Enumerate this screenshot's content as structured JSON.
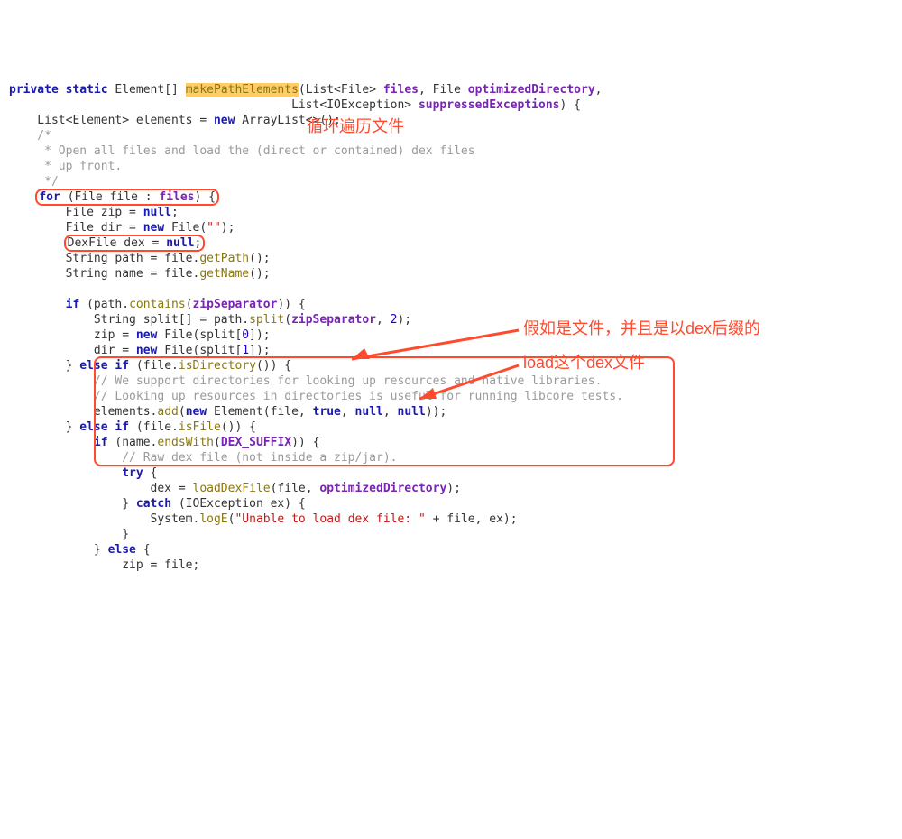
{
  "annotations": {
    "loop": "循环遍历文件",
    "isfile": "假如是文件，并且是以dex后缀的",
    "load": "load这个dex文件"
  },
  "code": {
    "sig1_pre": "private static ",
    "sig1_type": "Element[] ",
    "sig1_method": "makePathElements",
    "sig1_after": "(List<File> ",
    "sig1_p1": "files",
    "sig1_mid": ", File ",
    "sig1_p2": "optimizedDirectory",
    "sig1_end": ",",
    "sig2_pre": "                                        List<IOException> ",
    "sig2_p3": "suppressedExceptions",
    "sig2_end": ") {",
    "l3": "    List<Element> elements = ",
    "l3_new": "new",
    "l3_b": " ArrayList<>();",
    "c1": "    /*",
    "c2": "     * Open all files and load the (direct or contained) dex files",
    "c3": "     * up front.",
    "c4": "     */",
    "for_pre": "    ",
    "for_kw": "for",
    "for_body": " (File file : ",
    "for_files": "files",
    "for_end": ") {",
    "l_zip": "        File zip = ",
    "l_zip_null": "null",
    "l_zip_end": ";",
    "l_dir": "        File dir = ",
    "l_dir_new": "new",
    "l_dir_b": " File(",
    "l_dir_s": "\"\"",
    "l_dir_end": ");",
    "dex_pre": "        ",
    "dex_body": "DexFile dex = ",
    "dex_null": "null",
    "dex_end": ";",
    "l_path": "        String path = file.",
    "l_path_m": "getPath",
    "l_path_end": "();",
    "l_name": "        String name = file.",
    "l_name_m": "getName",
    "l_name_end": "();",
    "blank": "",
    "if1_pre": "        ",
    "if1_kw": "if",
    "if1_body": " (path.",
    "if1_m": "contains",
    "if1_p": "(",
    "if1_arg": "zipSeparator",
    "if1_end": ")) {",
    "spl_a": "            String split[] = path.",
    "spl_m": "split",
    "spl_b": "(",
    "spl_arg": "zipSeparator",
    "spl_c": ", ",
    "spl_n": "2",
    "spl_end": ");",
    "z2": "            zip = ",
    "z2_new": "new",
    "z2_b": " File(split[",
    "z2_n": "0",
    "z2_end": "]);",
    "d2": "            dir = ",
    "d2_new": "new",
    "d2_b": " File(split[",
    "d2_n": "1",
    "d2_end": "]);",
    "elif1_pre": "        } ",
    "elif1_kw": "else if",
    "elif1_body": " (file.",
    "elif1_m": "isDirectory",
    "elif1_end": "()) {",
    "cmt_a": "            // We support directories for looking up resources and native libraries.",
    "cmt_b": "            // Looking up resources in directories is useful for running libcore tests.",
    "add_a": "            elements.",
    "add_m": "add",
    "add_b": "(",
    "add_new": "new",
    "add_c": " Element(file, ",
    "add_true": "true",
    "add_d": ", ",
    "add_n1": "null",
    "add_e": ", ",
    "add_n2": "null",
    "add_end": "));",
    "elif2_pre": "        } ",
    "elif2_kw": "else if",
    "elif2_body": " (file.",
    "elif2_m": "isFile",
    "elif2_end": "()) {",
    "if2_pre": "            ",
    "if2_kw": "if",
    "if2_body": " (name.",
    "if2_m": "endsWith",
    "if2_p": "(",
    "if2_arg": "DEX_SUFFIX",
    "if2_end": ")) {",
    "cmt_raw": "                // Raw dex file (not inside a zip/jar).",
    "try_pre": "                ",
    "try_kw": "try",
    "try_end": " {",
    "load_a": "                    dex = ",
    "load_m": "loadDexFile",
    "load_b": "(file, ",
    "load_arg": "optimizedDirectory",
    "load_end": ");",
    "catch_pre": "                } ",
    "catch_kw": "catch",
    "catch_body": " (IOException ex) {",
    "log_a": "                    System.",
    "log_m": "logE",
    "log_b": "(",
    "log_s": "\"Unable to load dex file: \"",
    "log_c": " + file, ex);",
    "brace1": "                }",
    "else_pre": "            } ",
    "else_kw": "else",
    "else_end": " {",
    "last": "                zip = file;"
  }
}
